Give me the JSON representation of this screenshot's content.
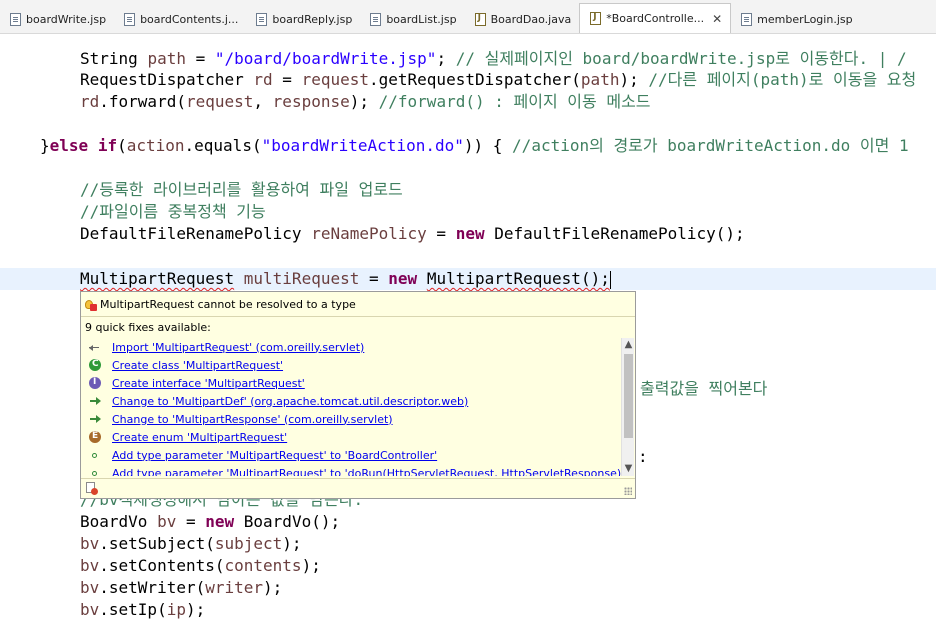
{
  "tabs": [
    {
      "label": "boardWrite.jsp",
      "icon": "jsp-file-icon",
      "active": false
    },
    {
      "label": "boardContents.j...",
      "icon": "jsp-file-icon",
      "active": false
    },
    {
      "label": "boardReply.jsp",
      "icon": "jsp-file-icon",
      "active": false
    },
    {
      "label": "boardList.jsp",
      "icon": "jsp-file-icon",
      "active": false
    },
    {
      "label": "BoardDao.java",
      "icon": "java-file-icon",
      "active": false
    },
    {
      "label": "*BoardControlle...",
      "icon": "java-file-icon",
      "active": true
    },
    {
      "label": "memberLogin.jsp",
      "icon": "jsp-file-icon",
      "active": false
    }
  ],
  "close_symbol": "✕",
  "code": {
    "l1_a": "String ",
    "l1_b": "path",
    "l1_c": " = ",
    "l1_d": "\"/board/boardWrite.jsp\"",
    "l1_e": "; ",
    "l1_f": "// 실제페이지인 board/boardWrite.jsp로 이동한다. | /",
    "l2_a": "RequestDispatcher ",
    "l2_b": "rd",
    "l2_c": " = ",
    "l2_d": "request",
    "l2_e": ".getRequestDispatcher(",
    "l2_f": "path",
    "l2_g": "); ",
    "l2_h": "//다른 페이지(path)로 이동을 요청",
    "l3_a": "rd",
    "l3_b": ".forward(",
    "l3_c": "request",
    "l3_d": ", ",
    "l3_e": "response",
    "l3_f": "); ",
    "l3_g": "//forward() : 페이지 이동 메소드",
    "l4_a": "}",
    "l4_b": "else",
    "l4_c": " ",
    "l4_d": "if",
    "l4_e": "(",
    "l4_f": "action",
    "l4_g": ".equals(",
    "l4_h": "\"boardWriteAction.do\"",
    "l4_i": ")) { ",
    "l4_j": "//action의 경로가 boardWriteAction.do 이면 1",
    "l5": "//등록한 라이브러리를 활용하여 파일 업로드",
    "l6": "//파일이름 중복정책 기능",
    "l7_a": "DefaultFileRenamePolicy ",
    "l7_b": "reNamePolicy",
    "l7_c": " = ",
    "l7_d": "new",
    "l7_e": " DefaultFileRenamePolicy();",
    "l8_a": "MultipartRequest",
    "l8_b": " ",
    "l8_c": "multiRequest",
    "l8_d": " = ",
    "l8_e": "new",
    "l8_f": " ",
    "l8_g": "MultipartRequest",
    "l8_h": "();",
    "peek_right": "출력값을 찍어본다",
    "peek_colon": ":",
    "l9": "//bv객체생성해서 담아는 값을 담는다.",
    "l10_a": "BoardVo ",
    "l10_b": "bv",
    "l10_c": " = ",
    "l10_d": "new",
    "l10_e": " BoardVo();",
    "l11_a": "bv",
    "l11_b": ".setSubject(",
    "l11_c": "subject",
    "l11_d": ");",
    "l12_a": "bv",
    "l12_b": ".setContents(",
    "l12_c": "contents",
    "l12_d": ");",
    "l13_a": "bv",
    "l13_b": ".setWriter(",
    "l13_c": "writer",
    "l13_d": ");",
    "l14_a": "bv",
    "l14_b": ".setIp(",
    "l14_c": "ip",
    "l14_d": ");"
  },
  "quickfix": {
    "title": "MultipartRequest cannot be resolved to a type",
    "subtitle": "9 quick fixes available:",
    "items": [
      {
        "label": "Import 'MultipartRequest' (com.oreilly.servlet)",
        "icon": "import-icon"
      },
      {
        "label": "Create class 'MultipartRequest'",
        "icon": "create-class-icon"
      },
      {
        "label": "Create interface 'MultipartRequest'",
        "icon": "create-interface-icon"
      },
      {
        "label": "Change to 'MultipartDef' (org.apache.tomcat.util.descriptor.web)",
        "icon": "change-to-icon"
      },
      {
        "label": "Change to 'MultipartResponse' (com.oreilly.servlet)",
        "icon": "change-to-icon"
      },
      {
        "label": "Create enum 'MultipartRequest'",
        "icon": "create-enum-icon"
      },
      {
        "label": "Add type parameter 'MultipartRequest' to 'BoardController'",
        "icon": "type-parameter-icon"
      },
      {
        "label": "Add type parameter 'MultipartRequest' to 'doRun(HttpServletRequest, HttpServletResponse)'",
        "icon": "type-parameter-icon"
      }
    ],
    "scroll_up": "▲",
    "scroll_down": "▼"
  },
  "colors": {
    "keyword": "#7f0055",
    "string": "#2a00ff",
    "comment": "#3f7f5f",
    "field": "#6a3e3e",
    "popup_bg": "#ffffe1",
    "link": "#0000ee",
    "current_line": "#e8f2fe"
  }
}
